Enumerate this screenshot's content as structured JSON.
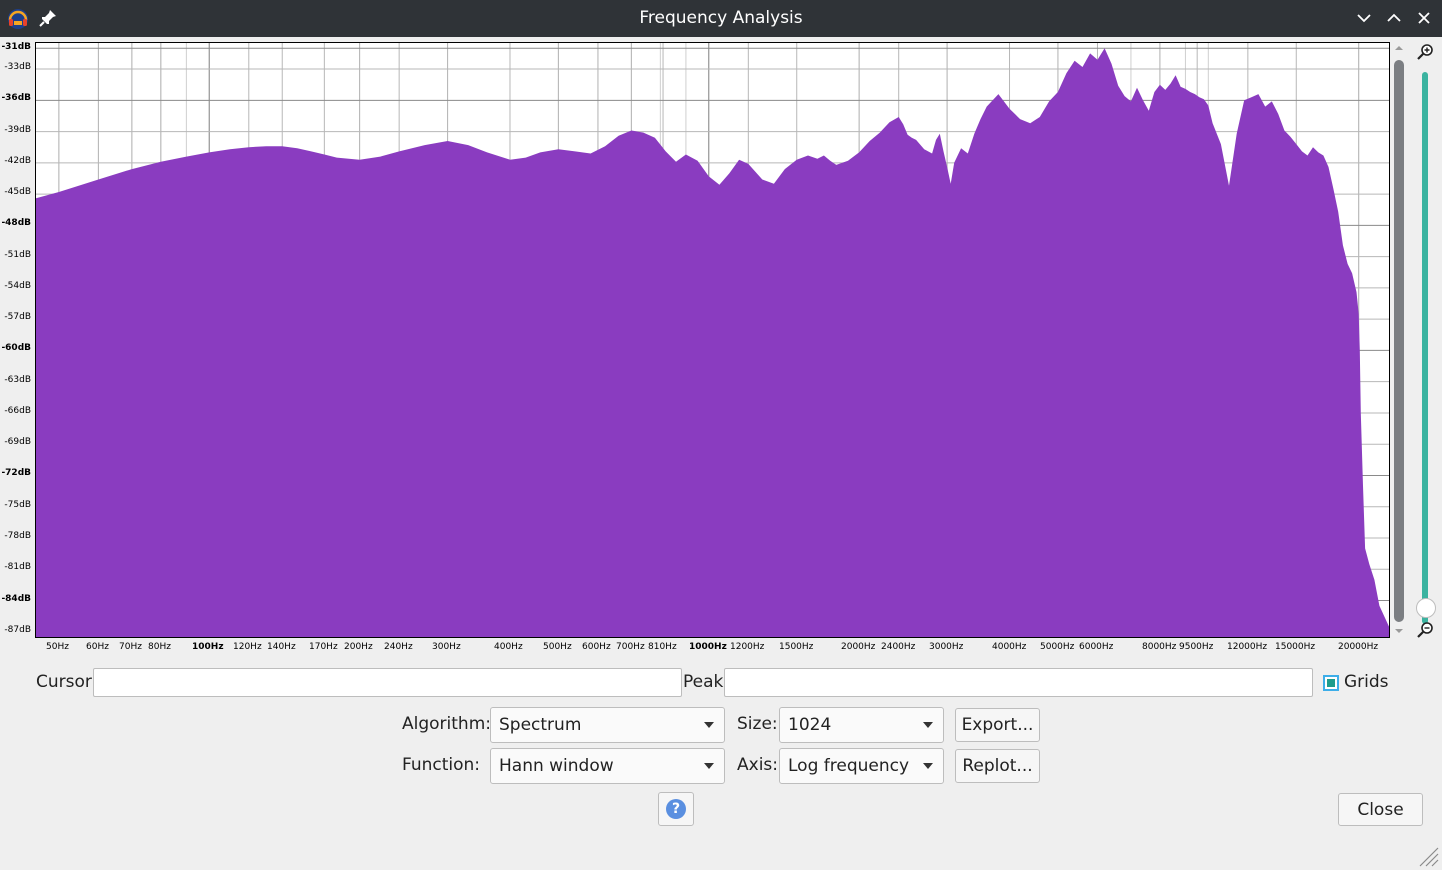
{
  "window": {
    "title": "Frequency Analysis"
  },
  "cursor": {
    "label": "Cursor:",
    "value": ""
  },
  "peak": {
    "label": "Peak:",
    "value": ""
  },
  "grids": {
    "label": "Grids",
    "checked": true
  },
  "algorithm": {
    "label": "Algorithm:",
    "value": "Spectrum"
  },
  "size": {
    "label": "Size:",
    "value": "1024"
  },
  "function": {
    "label": "Function:",
    "value": "Hann window"
  },
  "axis": {
    "label": "Axis:",
    "value": "Log frequency"
  },
  "buttons": {
    "export": "Export...",
    "replot": "Replot...",
    "close": "Close",
    "help": "?"
  },
  "icons": {
    "app": "audacity-app-icon",
    "pin": "pin-icon",
    "minimize": "chevron-down-icon",
    "maximize": "chevron-up-icon",
    "close": "close-icon",
    "zoom_in": "zoom-in-icon",
    "zoom_out": "zoom-out-icon",
    "help": "help-icon"
  },
  "colors": {
    "spectrum_fill": "#8a3cc0",
    "titlebar": "#2f3337",
    "zoom_bar": "#3bb3a0"
  },
  "chart_data": {
    "type": "area",
    "xscale": "log",
    "xlim": [
      45,
      23000
    ],
    "ylim": [
      -87.5,
      -30.5
    ],
    "grid": true,
    "x_ticks": [
      {
        "v": 50,
        "t": "50Hz",
        "b": false
      },
      {
        "v": 60,
        "t": "60Hz",
        "b": false
      },
      {
        "v": 70,
        "t": "70Hz",
        "b": false
      },
      {
        "v": 80,
        "t": "80Hz",
        "b": false
      },
      {
        "v": 100,
        "t": "100Hz",
        "b": true
      },
      {
        "v": 120,
        "t": "120Hz",
        "b": false
      },
      {
        "v": 140,
        "t": "140Hz",
        "b": false
      },
      {
        "v": 170,
        "t": "170Hz",
        "b": false
      },
      {
        "v": 200,
        "t": "200Hz",
        "b": false
      },
      {
        "v": 240,
        "t": "240Hz",
        "b": false
      },
      {
        "v": 300,
        "t": "300Hz",
        "b": false
      },
      {
        "v": 400,
        "t": "400Hz",
        "b": false
      },
      {
        "v": 500,
        "t": "500Hz",
        "b": false
      },
      {
        "v": 600,
        "t": "600Hz",
        "b": false
      },
      {
        "v": 700,
        "t": "700Hz",
        "b": false
      },
      {
        "v": 810,
        "t": "810Hz",
        "b": false
      },
      {
        "v": 1000,
        "t": "1000Hz",
        "b": true
      },
      {
        "v": 1200,
        "t": "1200Hz",
        "b": false
      },
      {
        "v": 1500,
        "t": "1500Hz",
        "b": false
      },
      {
        "v": 2000,
        "t": "2000Hz",
        "b": false
      },
      {
        "v": 2400,
        "t": "2400Hz",
        "b": false
      },
      {
        "v": 3000,
        "t": "3000Hz",
        "b": false
      },
      {
        "v": 4000,
        "t": "4000Hz",
        "b": false
      },
      {
        "v": 5000,
        "t": "5000Hz",
        "b": false
      },
      {
        "v": 6000,
        "t": "6000Hz",
        "b": false
      },
      {
        "v": 8000,
        "t": "8000Hz",
        "b": false
      },
      {
        "v": 9500,
        "t": "9500Hz",
        "b": false
      },
      {
        "v": 12000,
        "t": "12000Hz",
        "b": false
      },
      {
        "v": 15000,
        "t": "15000Hz",
        "b": false
      },
      {
        "v": 20000,
        "t": "20000Hz",
        "b": false
      }
    ],
    "y_ticks": [
      {
        "v": -31,
        "t": "-31dB",
        "b": true
      },
      {
        "v": -33,
        "t": "-33dB",
        "b": false
      },
      {
        "v": -36,
        "t": "-36dB",
        "b": true
      },
      {
        "v": -39,
        "t": "-39dB",
        "b": false
      },
      {
        "v": -42,
        "t": "-42dB",
        "b": false
      },
      {
        "v": -45,
        "t": "-45dB",
        "b": false
      },
      {
        "v": -48,
        "t": "-48dB",
        "b": true
      },
      {
        "v": -51,
        "t": "-51dB",
        "b": false
      },
      {
        "v": -54,
        "t": "-54dB",
        "b": false
      },
      {
        "v": -57,
        "t": "-57dB",
        "b": false
      },
      {
        "v": -60,
        "t": "-60dB",
        "b": true
      },
      {
        "v": -63,
        "t": "-63dB",
        "b": false
      },
      {
        "v": -66,
        "t": "-66dB",
        "b": false
      },
      {
        "v": -69,
        "t": "-69dB",
        "b": false
      },
      {
        "v": -72,
        "t": "-72dB",
        "b": true
      },
      {
        "v": -75,
        "t": "-75dB",
        "b": false
      },
      {
        "v": -78,
        "t": "-78dB",
        "b": false
      },
      {
        "v": -81,
        "t": "-81dB",
        "b": false
      },
      {
        "v": -84,
        "t": "-84dB",
        "b": true
      },
      {
        "v": -87,
        "t": "-87dB",
        "b": false
      }
    ],
    "x": [
      45,
      50,
      60,
      70,
      80,
      90,
      100,
      110,
      120,
      130,
      140,
      150,
      160,
      170,
      180,
      200,
      220,
      240,
      270,
      300,
      330,
      360,
      400,
      430,
      460,
      500,
      540,
      580,
      620,
      660,
      700,
      740,
      780,
      820,
      860,
      900,
      950,
      1000,
      1050,
      1100,
      1150,
      1200,
      1280,
      1350,
      1420,
      1500,
      1580,
      1650,
      1700,
      1750,
      1800,
      1900,
      2000,
      2100,
      2200,
      2300,
      2400,
      2450,
      2500,
      2550,
      2600,
      2700,
      2800,
      2850,
      2900,
      2950,
      3000,
      3050,
      3100,
      3200,
      3300,
      3400,
      3500,
      3600,
      3800,
      4000,
      4200,
      4400,
      4600,
      4800,
      5000,
      5200,
      5400,
      5600,
      5800,
      6000,
      6200,
      6400,
      6600,
      6800,
      7000,
      7200,
      7400,
      7600,
      7800,
      8000,
      8200,
      8400,
      8600,
      8800,
      9000,
      9200,
      9400,
      9600,
      9800,
      10000,
      10200,
      10600,
      11000,
      11400,
      11800,
      12200,
      12600,
      13000,
      13400,
      13800,
      14200,
      14600,
      15000,
      15400,
      15800,
      16200,
      16600,
      17000,
      17400,
      17800,
      18200,
      18600,
      19000,
      19400,
      19800,
      20000,
      20100,
      20200,
      20400,
      20600,
      21000,
      21500,
      22000,
      23000
    ],
    "values": [
      -45.4,
      -44.8,
      -43.6,
      -42.6,
      -41.9,
      -41.4,
      -41.0,
      -40.7,
      -40.5,
      -40.4,
      -40.4,
      -40.6,
      -40.9,
      -41.2,
      -41.5,
      -41.7,
      -41.4,
      -40.9,
      -40.3,
      -39.9,
      -40.3,
      -41.0,
      -41.7,
      -41.5,
      -41.0,
      -40.7,
      -40.9,
      -41.1,
      -40.4,
      -39.4,
      -38.9,
      -39.1,
      -39.6,
      -40.9,
      -41.9,
      -41.2,
      -41.8,
      -43.3,
      -44.1,
      -43.0,
      -41.7,
      -42.1,
      -43.6,
      -44.0,
      -42.6,
      -41.7,
      -41.3,
      -41.6,
      -41.3,
      -41.8,
      -42.2,
      -41.8,
      -41.0,
      -39.9,
      -39.1,
      -38.1,
      -37.6,
      -38.3,
      -39.3,
      -39.6,
      -39.8,
      -40.7,
      -41.1,
      -39.8,
      -39.2,
      -40.9,
      -42.4,
      -44.0,
      -42.0,
      -40.6,
      -41.1,
      -39.2,
      -37.8,
      -36.6,
      -35.4,
      -36.8,
      -37.8,
      -38.2,
      -37.6,
      -36.1,
      -35.2,
      -33.4,
      -32.2,
      -32.8,
      -31.5,
      -32.1,
      -31.0,
      -32.5,
      -34.6,
      -35.6,
      -36.1,
      -34.8,
      -36.0,
      -37.0,
      -35.2,
      -34.5,
      -35.0,
      -34.4,
      -33.6,
      -34.7,
      -34.9,
      -35.2,
      -35.4,
      -35.7,
      -35.9,
      -36.5,
      -38.2,
      -40.2,
      -44.2,
      -39.2,
      -36.0,
      -35.7,
      -35.4,
      -36.6,
      -36.1,
      -37.3,
      -38.9,
      -39.5,
      -40.2,
      -40.9,
      -41.3,
      -40.5,
      -41.0,
      -41.3,
      -42.4,
      -44.5,
      -46.7,
      -49.9,
      -51.7,
      -52.6,
      -54.4,
      -56.5,
      -60.0,
      -66.0,
      -73.0,
      -79.0,
      -80.5,
      -82.0,
      -84.5,
      -86.5,
      -87.5
    ]
  }
}
